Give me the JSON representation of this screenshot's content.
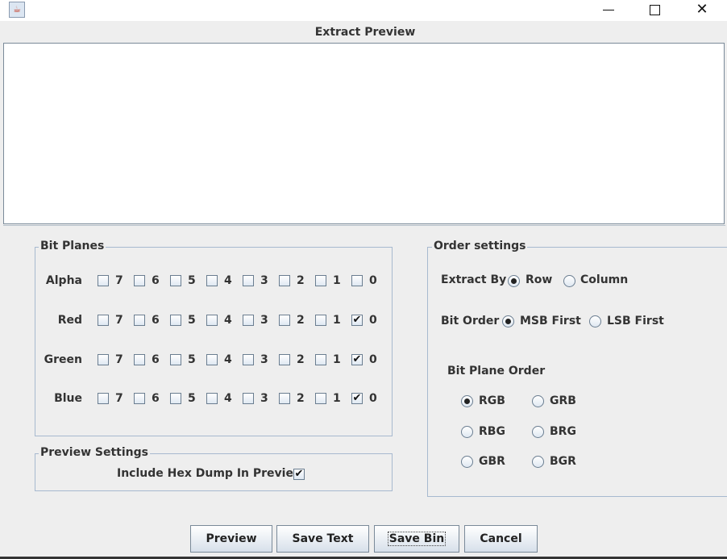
{
  "window": {
    "title": "",
    "min_glyph": "",
    "max_glyph": "",
    "close_glyph": "✕",
    "app_icon_glyph": "☕"
  },
  "preview": {
    "title": "Extract Preview",
    "content": ""
  },
  "bit_planes": {
    "legend": "Bit Planes",
    "bits": [
      "7",
      "6",
      "5",
      "4",
      "3",
      "2",
      "1",
      "0"
    ],
    "rows": [
      {
        "name": "Alpha",
        "checked": [
          false,
          false,
          false,
          false,
          false,
          false,
          false,
          false
        ]
      },
      {
        "name": "Red",
        "checked": [
          false,
          false,
          false,
          false,
          false,
          false,
          false,
          true
        ]
      },
      {
        "name": "Green",
        "checked": [
          false,
          false,
          false,
          false,
          false,
          false,
          false,
          true
        ]
      },
      {
        "name": "Blue",
        "checked": [
          false,
          false,
          false,
          false,
          false,
          false,
          false,
          true
        ]
      }
    ]
  },
  "preview_settings": {
    "legend": "Preview Settings",
    "hex_dump_label": "Include Hex Dump In Preview",
    "hex_dump_checked": true
  },
  "order_settings": {
    "legend": "Order settings",
    "extract_by": {
      "label": "Extract By",
      "options": [
        "Row",
        "Column"
      ],
      "selected": 0
    },
    "bit_order": {
      "label": "Bit Order",
      "options": [
        "MSB First",
        "LSB First"
      ],
      "selected": 0
    },
    "bit_plane_order": {
      "label": "Bit Plane Order",
      "options": [
        "RGB",
        "GRB",
        "RBG",
        "BRG",
        "GBR",
        "BGR"
      ],
      "selected": 0
    }
  },
  "buttons": {
    "preview": "Preview",
    "save_text": "Save Text",
    "save_bin": "Save Bin",
    "cancel": "Cancel"
  },
  "check_glyph": "✔"
}
